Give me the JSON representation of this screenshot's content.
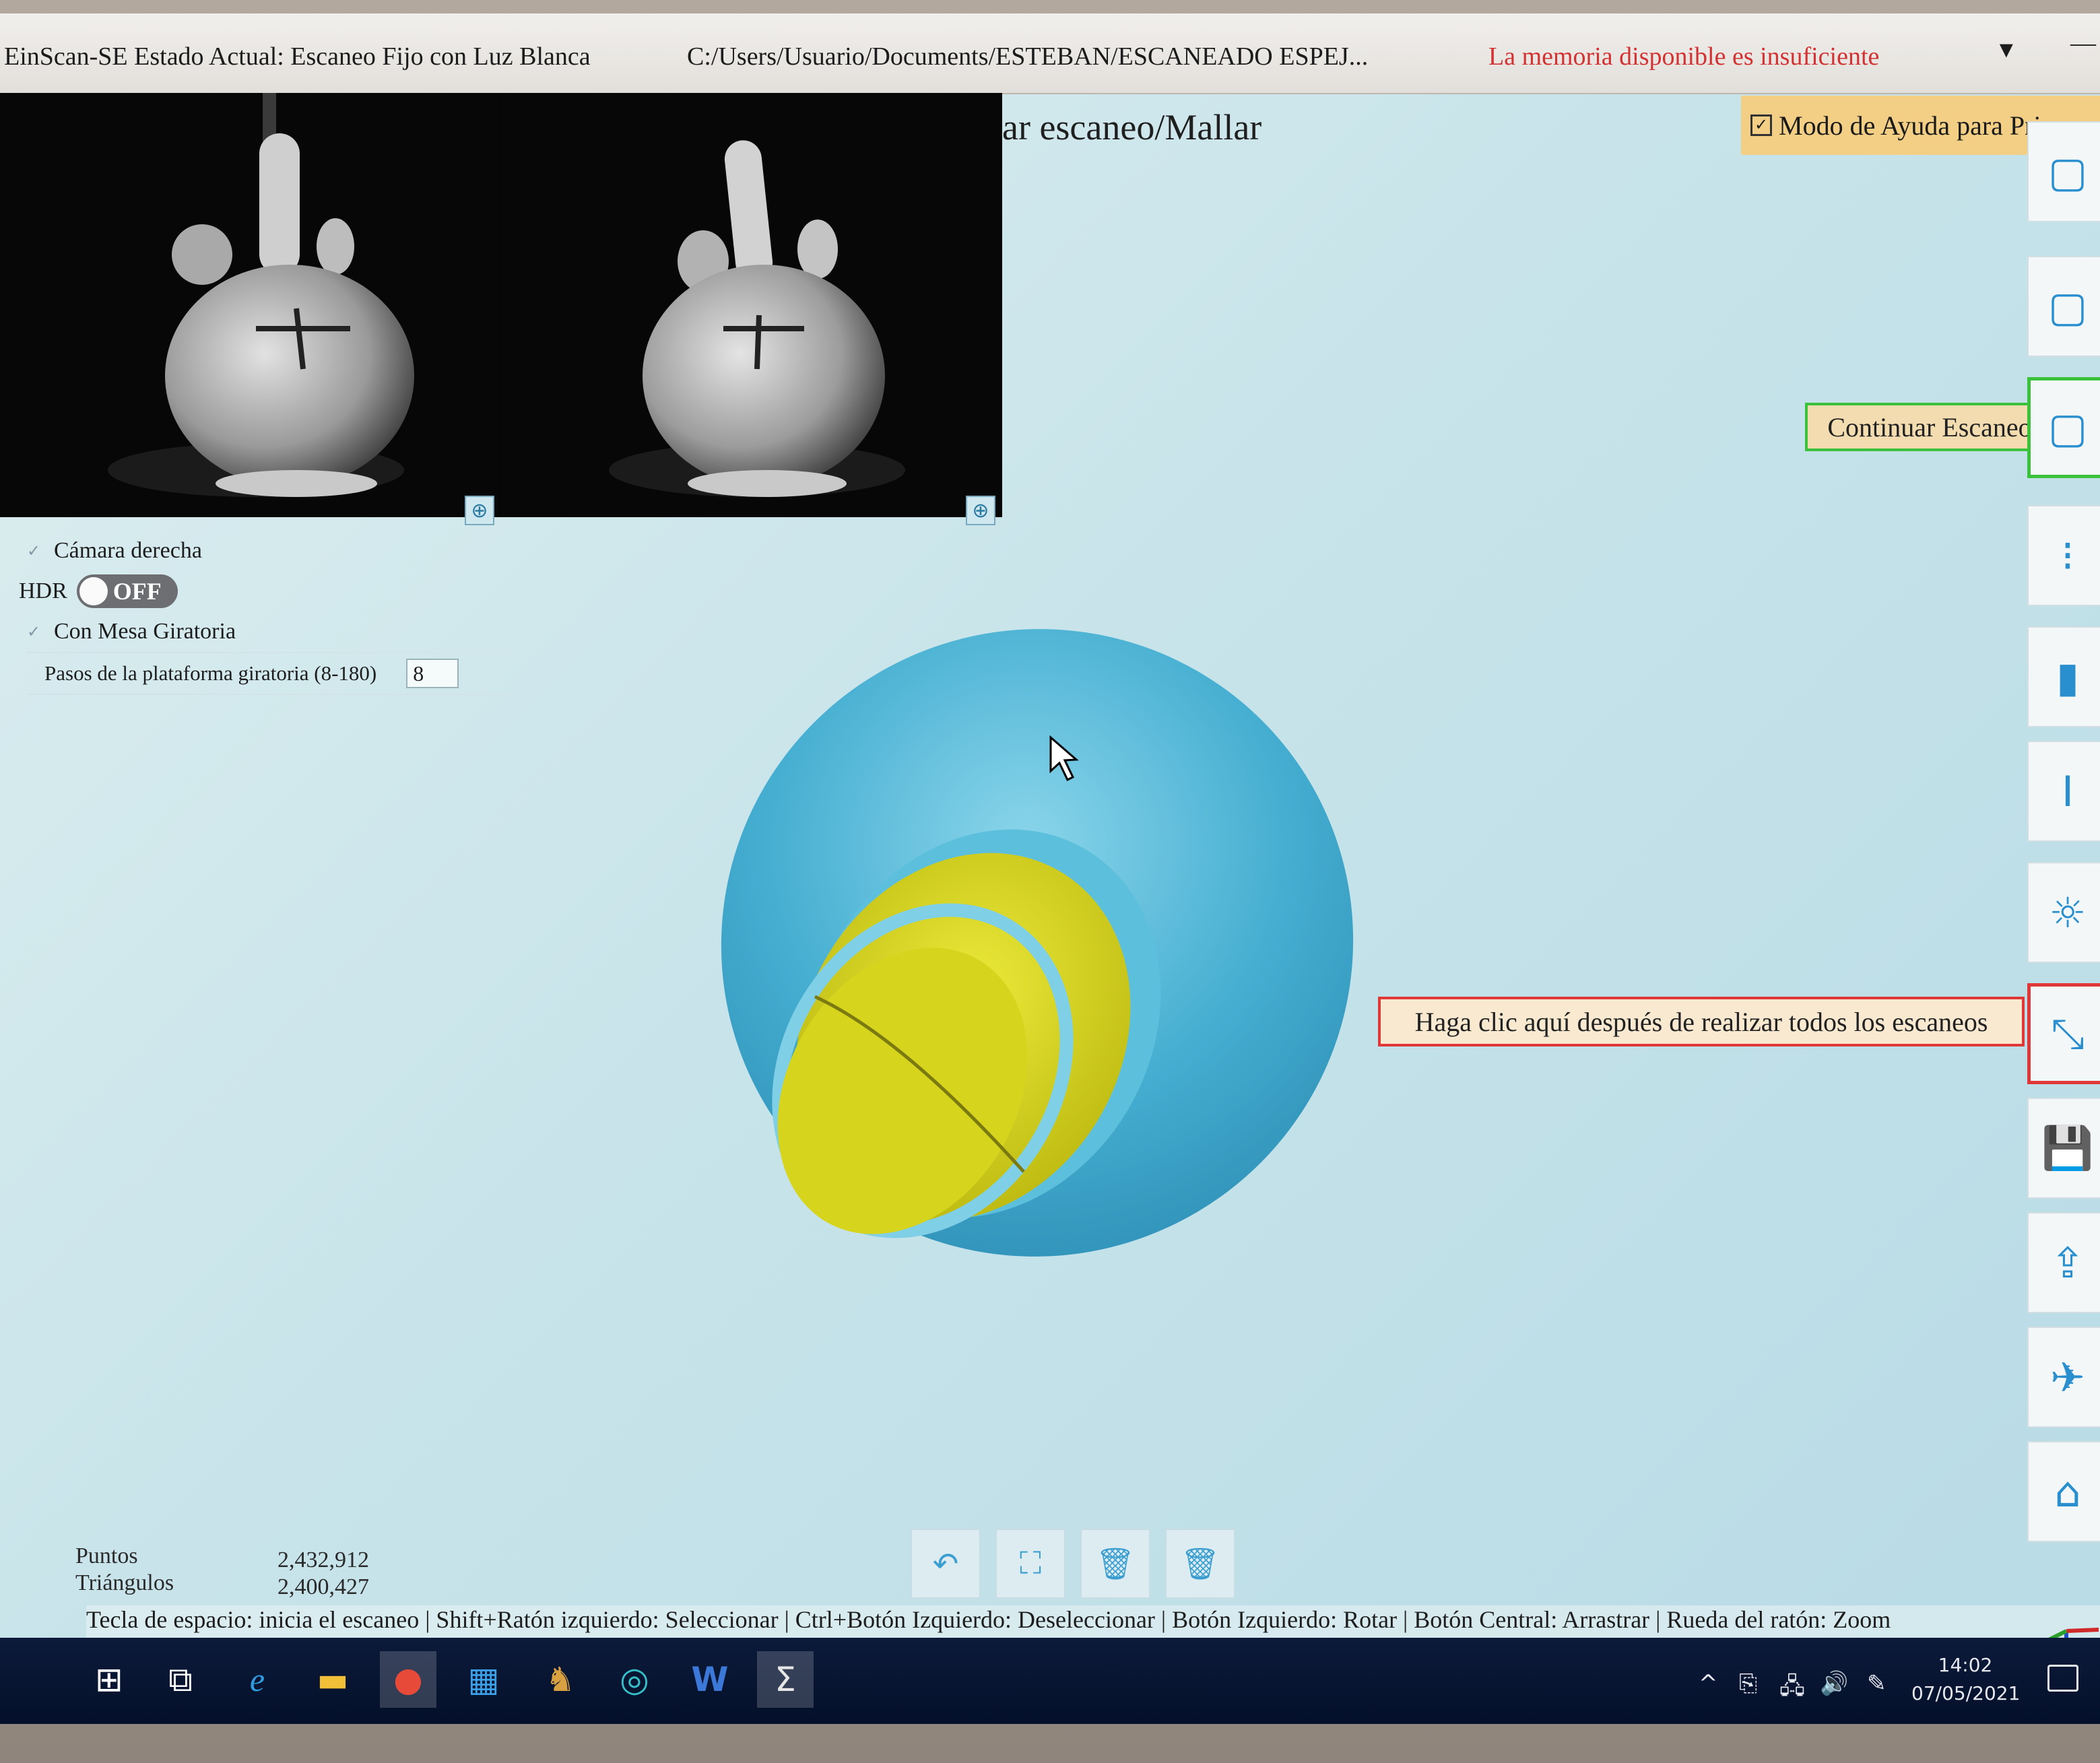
{
  "titlebar": {
    "app_status": "EinScan-SE Estado Actual: Escaneo Fijo con Luz Blanca",
    "project_path": "C:/Users/Usuario/Documents/ESTEBAN/ESCANEADO ESPEJ...",
    "memory_warning": "La memoria disponible es insuficiente",
    "dropdown_glyph": "▼",
    "minimize_glyph": "—",
    "warning_color": "#d23232"
  },
  "stage_title": "ar escaneo/Mallar",
  "help_mode": {
    "label": "Modo de Ayuda para Princ",
    "checked": true,
    "check_glyph": "✓"
  },
  "camera_preview": {
    "left_zoom_icon": "zoom-in-icon",
    "right_zoom_icon": "zoom-in-icon",
    "zoom_glyph": "⊕"
  },
  "settings": {
    "right_camera_label": "Cámara derecha",
    "hdr_label": "HDR",
    "hdr_state": "OFF",
    "turntable_label": "Con Mesa Giratoria",
    "turntable_steps_label": "Pasos de la plataforma giratoria (8-180)",
    "turntable_steps_value": "8",
    "check_glyph": "✓"
  },
  "callouts": {
    "continue_scan": "Continuar Escaneo",
    "finish_hint": "Haga clic aquí después de realizar todos los escaneos",
    "continue_border": "#3cc13c",
    "finish_border": "#e03838"
  },
  "stats": {
    "points_label": "Puntos",
    "points_value": "2,432,912",
    "triangles_label": "Triángulos",
    "triangles_value": "2,400,427"
  },
  "hint_bar": "Tecla de espacio: inicia el escaneo | Shift+Ratón izquierdo: Seleccionar | Ctrl+Botón Izquierdo: Deseleccionar | Botón Izquierdo: Rotar | Botón Central: Arrastrar | Rueda del ratón: Zoom",
  "model_colors": {
    "shell": "#3ea8cc",
    "shell_light": "#7fcfe6",
    "selection": "#d9d41a"
  },
  "right_toolbar": {
    "icons": [
      "scan-icon",
      "continue-scan-icon",
      "settings-icon",
      "align-icon",
      "marker-icon",
      "light-icon",
      "finish-scan-icon",
      "save-icon",
      "export-icon",
      "share-icon",
      "home-icon"
    ],
    "glyphs": [
      "▢",
      "▢",
      "⁝",
      "▮",
      "I",
      "☼",
      "⤡",
      "💾",
      "⇪",
      "✈",
      "⌂"
    ]
  },
  "bottom_tools": {
    "icons": [
      "undo-icon",
      "fit-view-icon",
      "delete-icon",
      "delete-all-icon"
    ],
    "glyphs": [
      "↶",
      "⛶",
      "🗑",
      "🗑"
    ]
  },
  "taskbar": {
    "apps": [
      "windows-start-icon",
      "task-view-icon",
      "internet-explorer-icon",
      "file-explorer-icon",
      "chrome-icon",
      "calculator-app-icon",
      "game-app-icon",
      "edge-icon",
      "word-icon",
      "einscan-icon"
    ],
    "glyphs": [
      "⊞",
      "⧉",
      "e",
      "▬",
      "●",
      "▦",
      "♞",
      "◎",
      "W",
      "Ʃ"
    ],
    "tray_glyphs": [
      "^",
      "⎘",
      "🖧",
      "🔊",
      "✎"
    ],
    "time": "14:02",
    "date": "07/05/2021"
  }
}
